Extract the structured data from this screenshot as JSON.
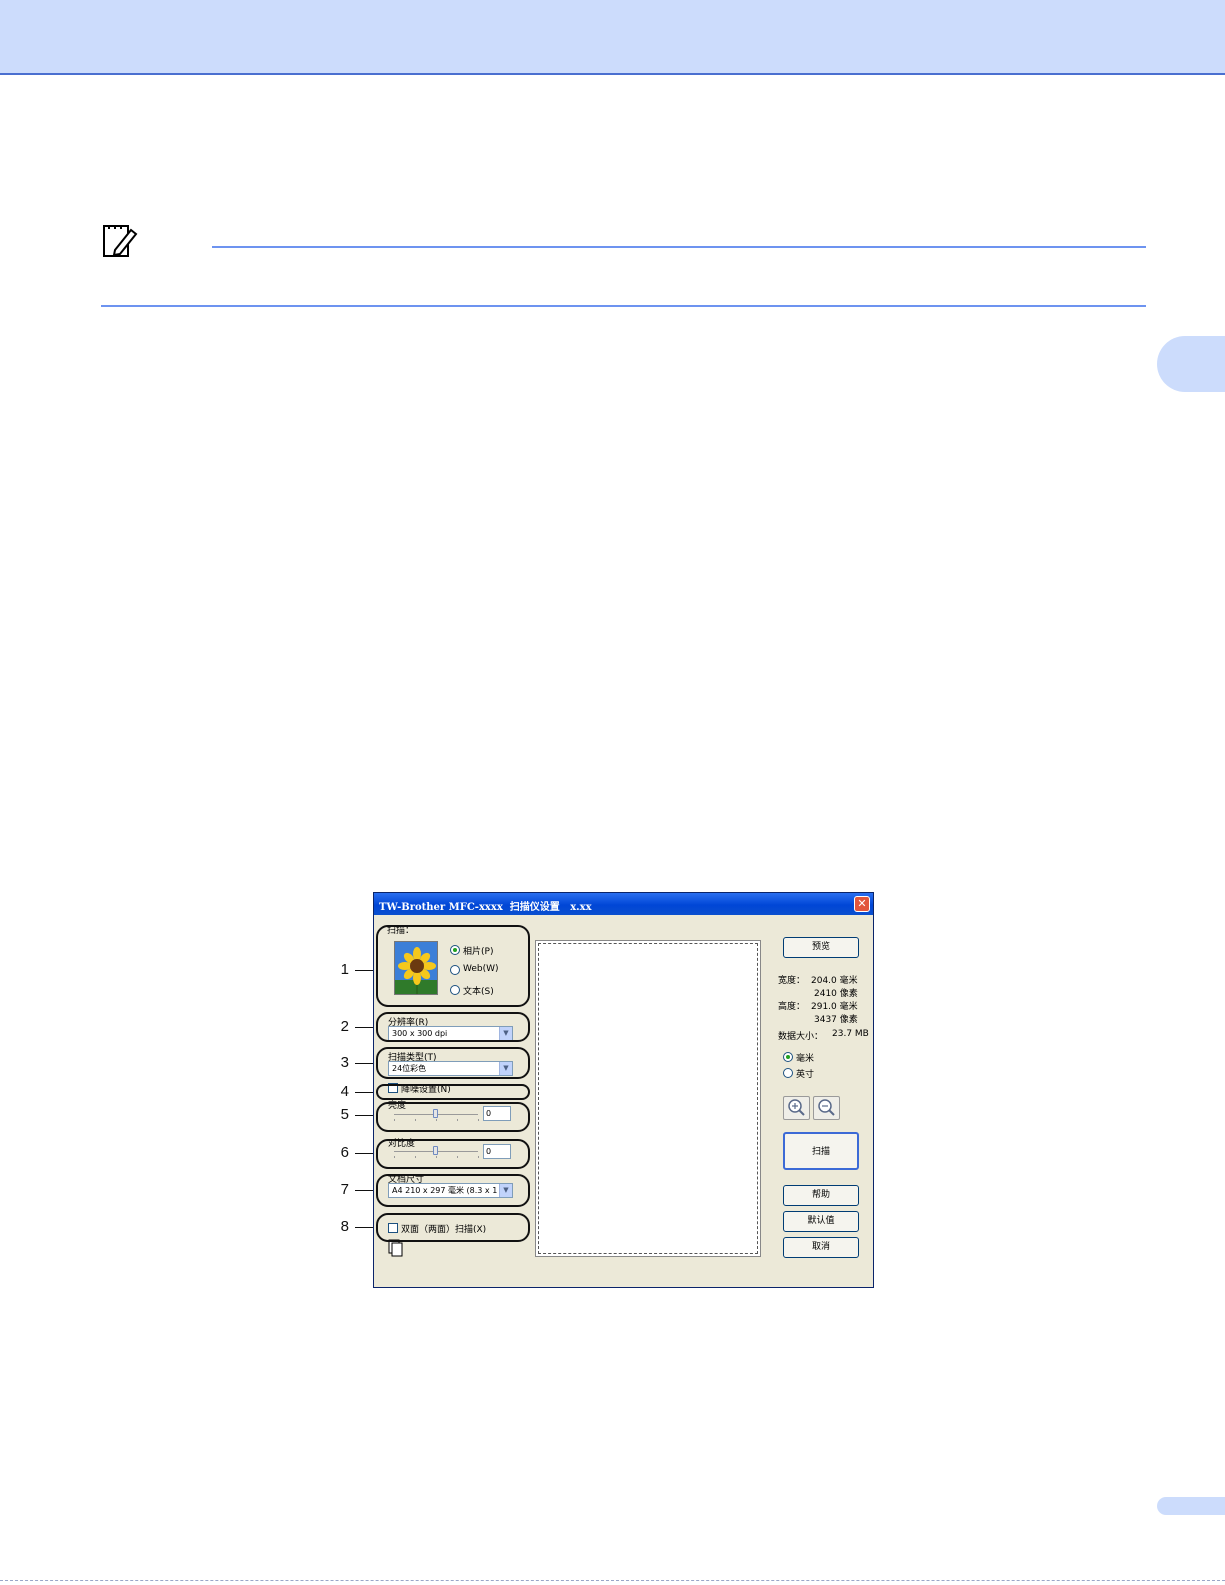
{
  "dialog": {
    "title": "TW-Brother MFC-xxxx  扫描仪设置   x.xx",
    "close_glyph": "✕",
    "scan_section": {
      "label": "扫描：",
      "options": [
        "相片(P)",
        "Web(W)",
        "文本(S)"
      ],
      "selected_index": 0
    },
    "resolution": {
      "label": "分辨率(R)",
      "value": "300 x 300 dpi"
    },
    "scan_type": {
      "label": "扫描类型(T)",
      "value": "24位彩色"
    },
    "noise_reduction": {
      "label": "降噪设置(N)",
      "checked": false
    },
    "brightness": {
      "label": "亮度",
      "value": "0",
      "level": 0.5
    },
    "contrast": {
      "label": "对比度",
      "value": "0",
      "level": 0.5
    },
    "document_size": {
      "label": "文档尺寸",
      "value": "A4 210 x 297 毫米 (8.3 x 1"
    },
    "duplex": {
      "label": "双面（两面）扫描(X)",
      "checked": false
    },
    "buttons": {
      "preview": "预览",
      "scan": "扫描",
      "help": "帮助",
      "default": "默认值",
      "cancel": "取消"
    },
    "info": {
      "width_label": "宽度：",
      "width_mm": "204.0 毫米",
      "width_px": "2410 像素",
      "height_label": "高度：",
      "height_mm": "291.0 毫米",
      "height_px": "3437 像素",
      "datasize_label": "数据大小：",
      "datasize_value": "23.7 MB"
    },
    "units": {
      "options": [
        "毫米",
        "英寸"
      ],
      "selected_index": 0
    }
  },
  "callouts": [
    "1",
    "2",
    "3",
    "4",
    "5",
    "6",
    "7",
    "8"
  ],
  "colors": {
    "header_band": "#ccdcfc",
    "rule": "#6d93f0",
    "titlebar": "#0046d6",
    "dialog_bg": "#ece9d8"
  }
}
